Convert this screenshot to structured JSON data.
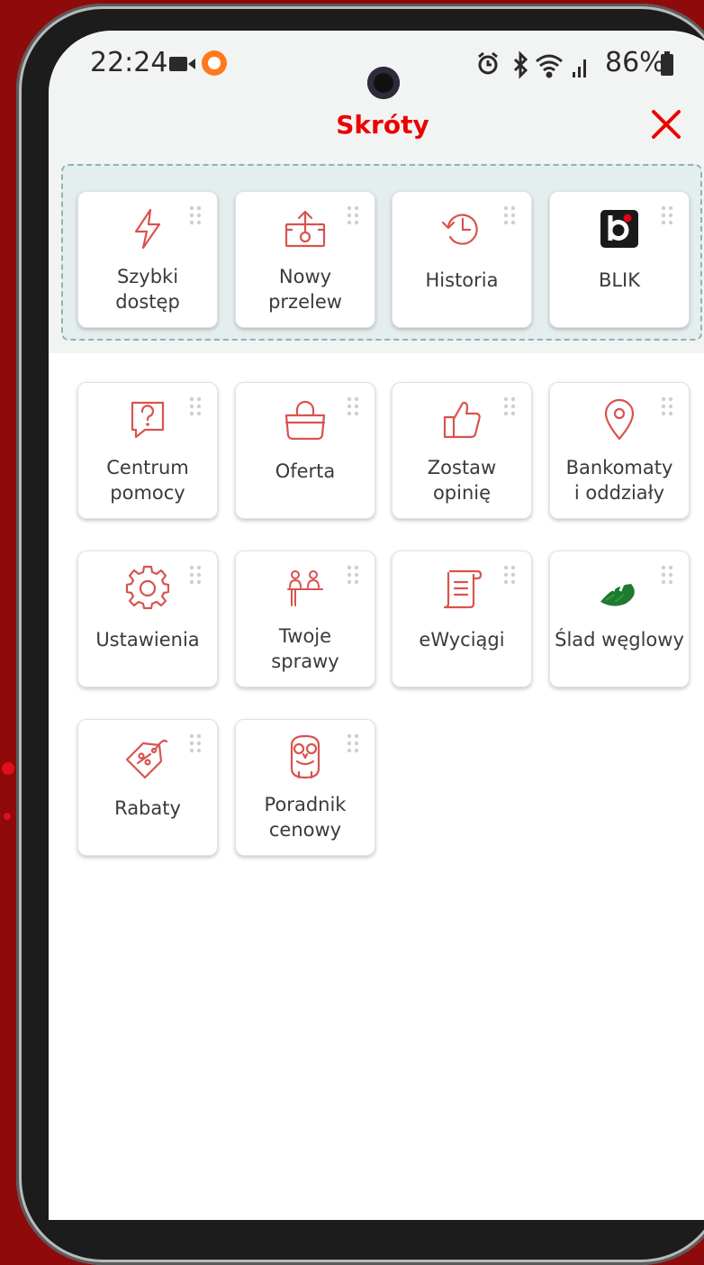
{
  "status_bar": {
    "time": "22:24",
    "battery": "86%"
  },
  "header": {
    "title": "Skróty",
    "close_icon": "close-icon"
  },
  "favorites": [
    {
      "label": "Szybki\ndostęp",
      "icon": "lightning-icon"
    },
    {
      "label": "Nowy\nprzelew",
      "icon": "money-transfer-icon"
    },
    {
      "label": "Historia",
      "icon": "history-icon"
    },
    {
      "label": "BLIK",
      "icon": "blik-logo-icon"
    }
  ],
  "shortcuts": [
    {
      "label": "Centrum\npomocy",
      "icon": "help-chat-icon"
    },
    {
      "label": "Oferta",
      "icon": "shopping-bag-icon"
    },
    {
      "label": "Zostaw\nopinię",
      "icon": "thumbs-up-icon"
    },
    {
      "label": "Bankomaty\ni oddziały",
      "icon": "location-pin-icon"
    },
    {
      "label": "Ustawienia",
      "icon": "gear-icon"
    },
    {
      "label": "Twoje\nsprawy",
      "icon": "people-desk-icon"
    },
    {
      "label": "eWyciągi",
      "icon": "document-scroll-icon"
    },
    {
      "label": "Ślad węglowy",
      "icon": "leaf-icon"
    },
    {
      "label": "Rabaty",
      "icon": "discount-tag-icon"
    },
    {
      "label": "Poradnik\ncenowy",
      "icon": "owl-icon"
    }
  ],
  "colors": {
    "brand_red": "#ec0000",
    "icon_red": "#d9534f",
    "background": "#8f0a0a"
  }
}
